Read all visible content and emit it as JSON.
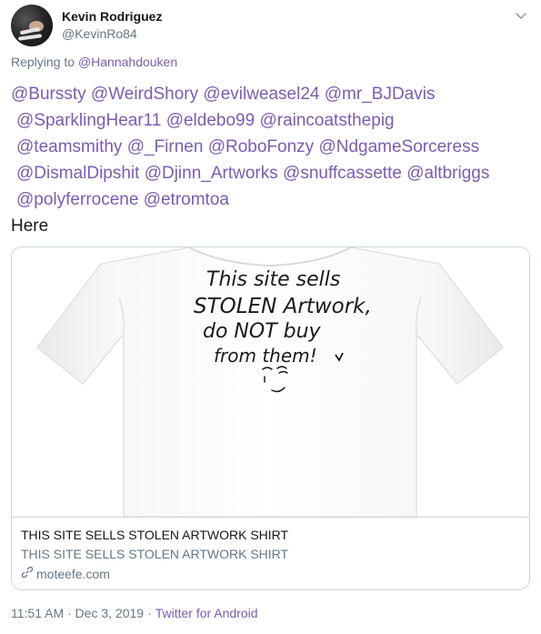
{
  "tweet": {
    "author_name": "Kevin Rodriguez",
    "author_handle": "@KevinRo84",
    "replying_prefix": "Replying to",
    "replying_to": "@Hannahdouken",
    "lines": [
      [
        "@Burssty",
        "@WeirdShory",
        "@evilweasel24",
        "@mr_BJDavis"
      ],
      [
        "@SparklingHear11",
        "@eldebo99",
        "@raincoatsthepig"
      ],
      [
        "@teamsmithy",
        "@_Firnen",
        "@RoboFonzy",
        "@NdgameSorceress"
      ],
      [
        "@DismalDipshit",
        "@Djinn_Artworks",
        "@snuffcassette",
        "@altbriggs"
      ],
      [
        "@polyferrocene",
        "@etromtoa"
      ]
    ],
    "body": "Here",
    "timestamp": "11:51 AM · Dec 3, 2019",
    "source": "Twitter for Android"
  },
  "card": {
    "shirt_text_lines": [
      "This site sells",
      "STOLEN Artwork,",
      "do NOT buy",
      "from them!"
    ],
    "title": "THIS SITE SELLS STOLEN ARTWORK SHIRT",
    "description": "THIS SITE SELLS STOLEN ARTWORK SHIRT",
    "domain": "moteefe.com"
  },
  "colors": {
    "mention": "#7c5cb0",
    "secondary_text": "#657786",
    "border": "#ccd6dd"
  },
  "icons": {
    "caret": "chevron-down-icon",
    "link": "link-icon"
  }
}
